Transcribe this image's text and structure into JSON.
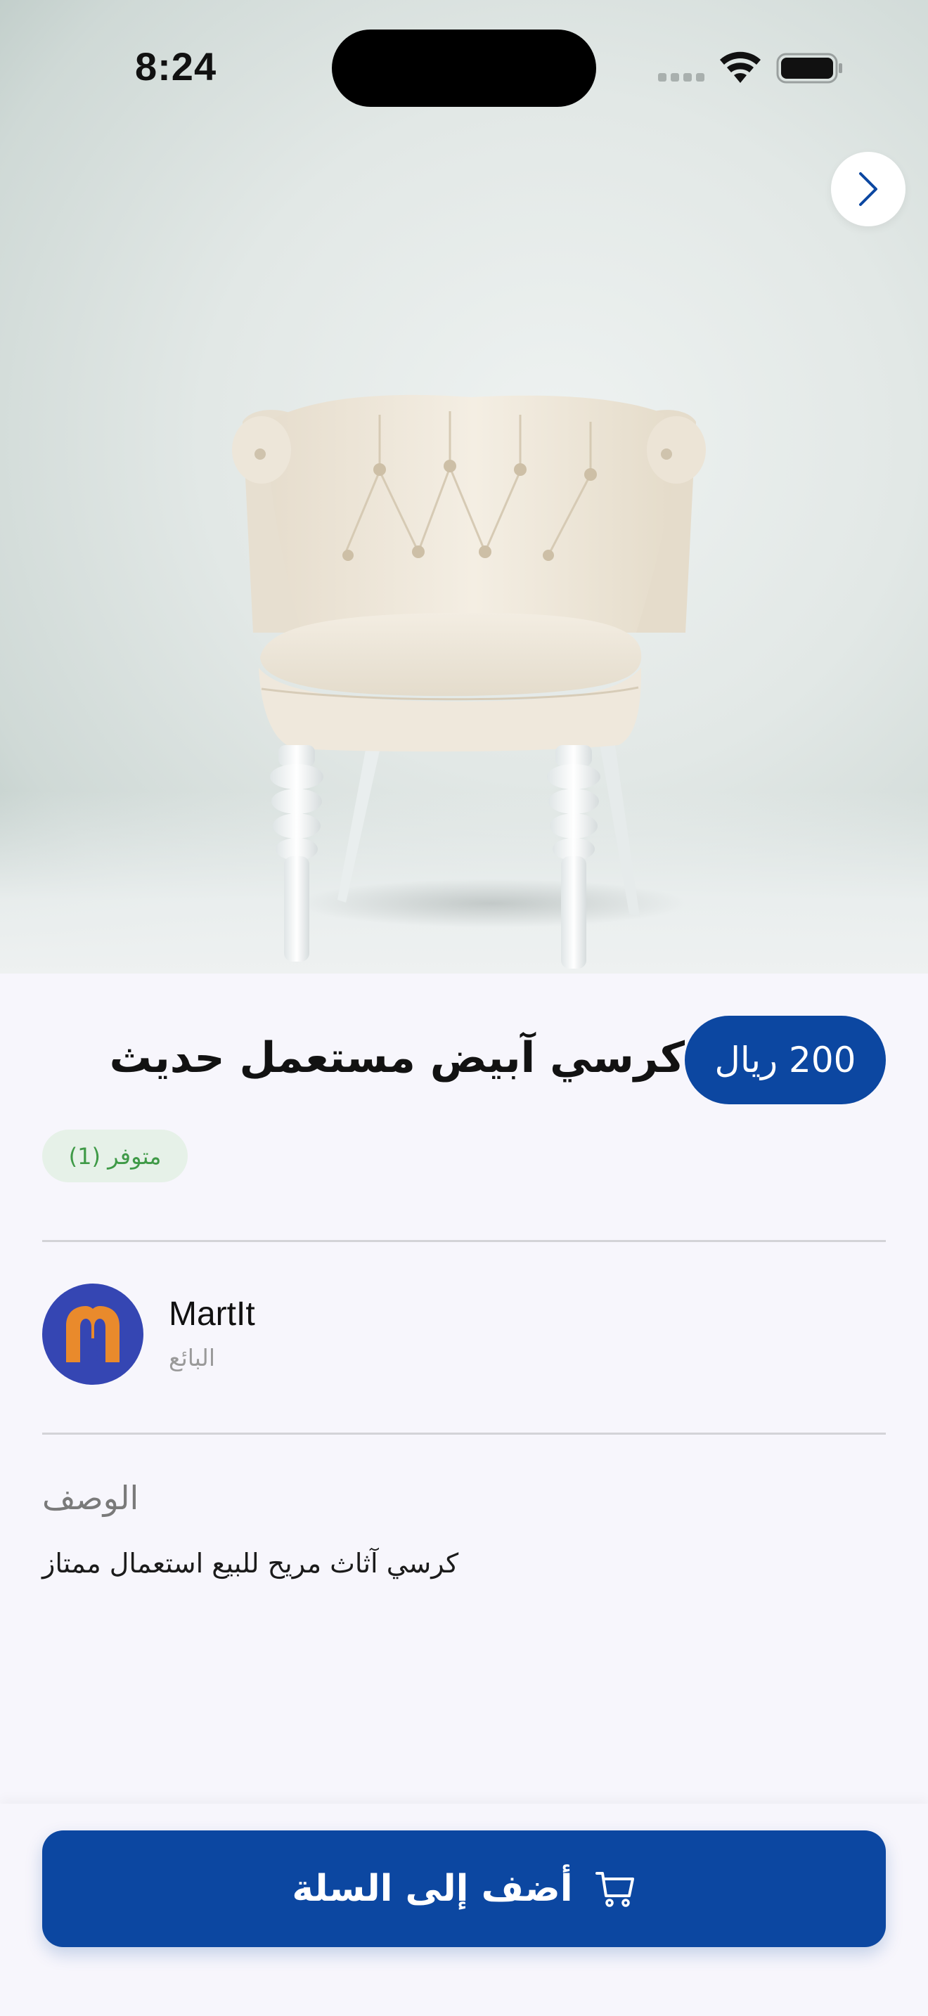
{
  "status_bar": {
    "time": "8:24"
  },
  "gallery": {
    "image_subject": "white tufted armchair",
    "next_icon": "chevron-right-icon"
  },
  "product": {
    "price": "200 ريال",
    "title": "كرسي آبيض مستعمل حديث",
    "stock": "متوفر (1)"
  },
  "seller": {
    "name": "MartIt",
    "role": "البائع",
    "avatar_icon": "martit-logo-icon"
  },
  "description": {
    "heading": "الوصف",
    "text": "كرسي آثاث مريح للبيع استعمال ممتاز"
  },
  "actions": {
    "add_to_cart_label": "أضف إلى السلة",
    "cart_icon": "cart-icon"
  },
  "colors": {
    "primary": "#0c47a1",
    "background": "#f7f6fc",
    "stock_text": "#3f9a47",
    "stock_bg": "#e6f1e8",
    "avatar_bg": "#3546b3",
    "avatar_logo": "#e98a2c"
  }
}
